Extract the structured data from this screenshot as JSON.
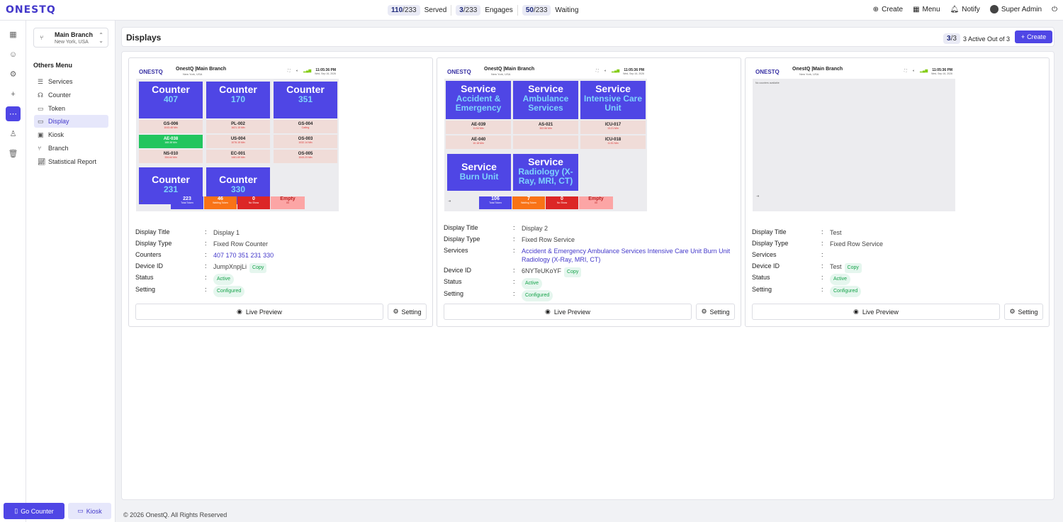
{
  "app": {
    "logo": "ONESTQ"
  },
  "stats": [
    {
      "num": "110",
      "den": "/233",
      "label": "Served"
    },
    {
      "num": "3",
      "den": "/233",
      "label": "Engages"
    },
    {
      "num": "50",
      "den": "/233",
      "label": "Waiting"
    }
  ],
  "topnav": {
    "create": "Create",
    "menu": "Menu",
    "notify": "Notify",
    "user": "Super Admin"
  },
  "sidebar": {
    "branch_name": "Main Branch",
    "branch_loc": "New York, USA",
    "section": "Others Menu",
    "items": [
      {
        "label": "Services",
        "icon": "services-icon"
      },
      {
        "label": "Counter",
        "icon": "counter-icon"
      },
      {
        "label": "Token",
        "icon": "token-icon"
      },
      {
        "label": "Display",
        "icon": "display-icon"
      },
      {
        "label": "Kiosk",
        "icon": "kiosk-icon"
      },
      {
        "label": "Branch",
        "icon": "branch-icon"
      },
      {
        "label": "Statistical Report",
        "icon": "report-icon"
      }
    ],
    "go_counter": "Go Counter",
    "kiosk": "Kiosk"
  },
  "header": {
    "title": "Displays",
    "active_num": "3",
    "active_den": "/3",
    "active_text": "3 Active Out of 3",
    "create": "Create"
  },
  "preview_common": {
    "logo": "ONESTQ",
    "title": "OnestQ |Main Branch",
    "sub": "New York, USA",
    "time": "11:05:36 PM",
    "date": "Wed, Sep 16, 2026"
  },
  "d1": {
    "c1": "Counter",
    "n1": "407",
    "c2": "Counter",
    "n2": "170",
    "c3": "Counter",
    "n3": "351",
    "c4": "Counter",
    "n4": "231",
    "c5": "Counter",
    "n5": "330",
    "t1": "GS-006",
    "t1s": "1043.48 Min",
    "t2": "PL-002",
    "t2s": "1621.15 Min",
    "t3": "GS-004",
    "t3s": "Calling",
    "t4": "AE-038",
    "t4s": "168.38 Min",
    "t5": "US-004",
    "t5s": "1076.15 Min",
    "t6": "OS-003",
    "t6s": "1032.14 Min",
    "t7": "NS-010",
    "t7s": "334.64 Min",
    "t8": "EC-001",
    "t8s": "1461.69 Min",
    "t9": "OS-005",
    "t9s": "1043.23 Min",
    "f1": "223",
    "f1s": "Total Token",
    "f2": "46",
    "f2s": "Waiting Token",
    "f3": "0",
    "f3s": "No Show",
    "f4": "Empty",
    "f4s": "00"
  },
  "d2": {
    "s1": "Service",
    "s1n": "Accident & Emergency",
    "s2": "Service",
    "s2n": "Ambulance Services",
    "s3": "Service",
    "s3n": "Intensive Care Unit",
    "s4": "Service",
    "s4n": "Burn Unit",
    "s5": "Service",
    "s5n": "Radiology (X-Ray, MRI, CT)",
    "t1": "AE-039",
    "t1s": "11.54 Min",
    "t2": "AS-021",
    "t2s": "302.56 Min",
    "t3": "ICU-017",
    "t3s": "13.21 Min",
    "t4": "AE-040",
    "t4s": "10.18 Min",
    "t5": "ICU-018",
    "t5s": "11.51 Min",
    "f1": "106",
    "f1s": "Total Token",
    "f2": "7",
    "f2s": "Waiting Token",
    "f3": "0",
    "f3s": "No Show",
    "f4": "Empty",
    "f4s": "00"
  },
  "d3": {
    "empty": "No counters available"
  },
  "cards": [
    {
      "title_k": "Display Title",
      "title_v": "Display 1",
      "type_k": "Display Type",
      "type_v": "Fixed Row Counter",
      "list_k": "Counters",
      "list_v": "407 170 351 231 330",
      "dev_k": "Device ID",
      "dev_v": "JumpXnpjLi",
      "copy": "Copy",
      "status_k": "Status",
      "status_v": "Active",
      "set_k": "Setting",
      "set_v": "Configured",
      "live": "Live Preview",
      "setting": "Setting"
    },
    {
      "title_k": "Display Title",
      "title_v": "Display 2",
      "type_k": "Display Type",
      "type_v": "Fixed Row Service",
      "list_k": "Services",
      "list_v": "Accident & Emergency Ambulance Services Intensive Care Unit Burn Unit Radiology (X-Ray, MRI, CT)",
      "dev_k": "Device ID",
      "dev_v": "6NYTeUKoYF",
      "copy": "Copy",
      "status_k": "Status",
      "status_v": "Active",
      "set_k": "Setting",
      "set_v": "Configured",
      "live": "Live Preview",
      "setting": "Setting"
    },
    {
      "title_k": "Display Title",
      "title_v": "Test",
      "type_k": "Display Type",
      "type_v": "Fixed Row Service",
      "list_k": "Services",
      "list_v": "",
      "dev_k": "Device ID",
      "dev_v": "Test",
      "copy": "Copy",
      "status_k": "Status",
      "status_v": "Active",
      "set_k": "Setting",
      "set_v": "Configured",
      "live": "Live Preview",
      "setting": "Setting"
    }
  ],
  "footer": {
    "copyright": "© 2026 OnestQ. All Rights Reserved"
  }
}
